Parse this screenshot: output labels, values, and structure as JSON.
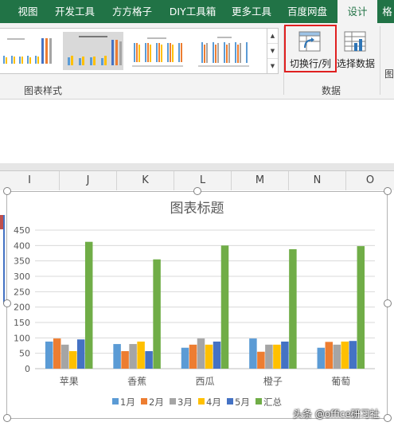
{
  "ribbon": {
    "tabs": [
      {
        "label": "视图"
      },
      {
        "label": "开发工具"
      },
      {
        "label": "方方格子"
      },
      {
        "label": "DIY工具箱"
      },
      {
        "label": "更多工具"
      },
      {
        "label": "百度网盘"
      },
      {
        "label": "设计",
        "active": true
      },
      {
        "label": "格"
      }
    ],
    "styles_group_label": "图表样式",
    "data_group_label": "数据",
    "switch_row_col_label": "切换行/列",
    "select_data_label": "选择数据",
    "next_group_label": "图",
    "accent": "#217346"
  },
  "columns": [
    "I",
    "J",
    "K",
    "L",
    "M",
    "N",
    "O"
  ],
  "chart_data": {
    "type": "bar",
    "title": "图表标题",
    "categories": [
      "苹果",
      "香蕉",
      "西瓜",
      "橙子",
      "葡萄"
    ],
    "ylim": [
      0,
      450
    ],
    "yticks": [
      "0",
      "50",
      "100",
      "150",
      "200",
      "250",
      "300",
      "350",
      "400",
      "450"
    ],
    "series": [
      {
        "name": "1月",
        "color": "#5b9bd5",
        "values": [
          88,
          80,
          68,
          98,
          68
        ]
      },
      {
        "name": "2月",
        "color": "#ed7d31",
        "values": [
          98,
          57,
          78,
          55,
          87
        ]
      },
      {
        "name": "3月",
        "color": "#a5a5a5",
        "values": [
          78,
          80,
          98,
          78,
          78
        ]
      },
      {
        "name": "4月",
        "color": "#ffc000",
        "values": [
          57,
          88,
          78,
          78,
          88
        ]
      },
      {
        "name": "5月",
        "color": "#4472c4",
        "values": [
          95,
          57,
          88,
          88,
          90
        ]
      },
      {
        "name": "汇总",
        "color": "#70ad47",
        "values": [
          412,
          355,
          400,
          388,
          398
        ]
      }
    ],
    "grid": true,
    "legend": "bottom"
  },
  "watermark": "头条 @office研习社"
}
